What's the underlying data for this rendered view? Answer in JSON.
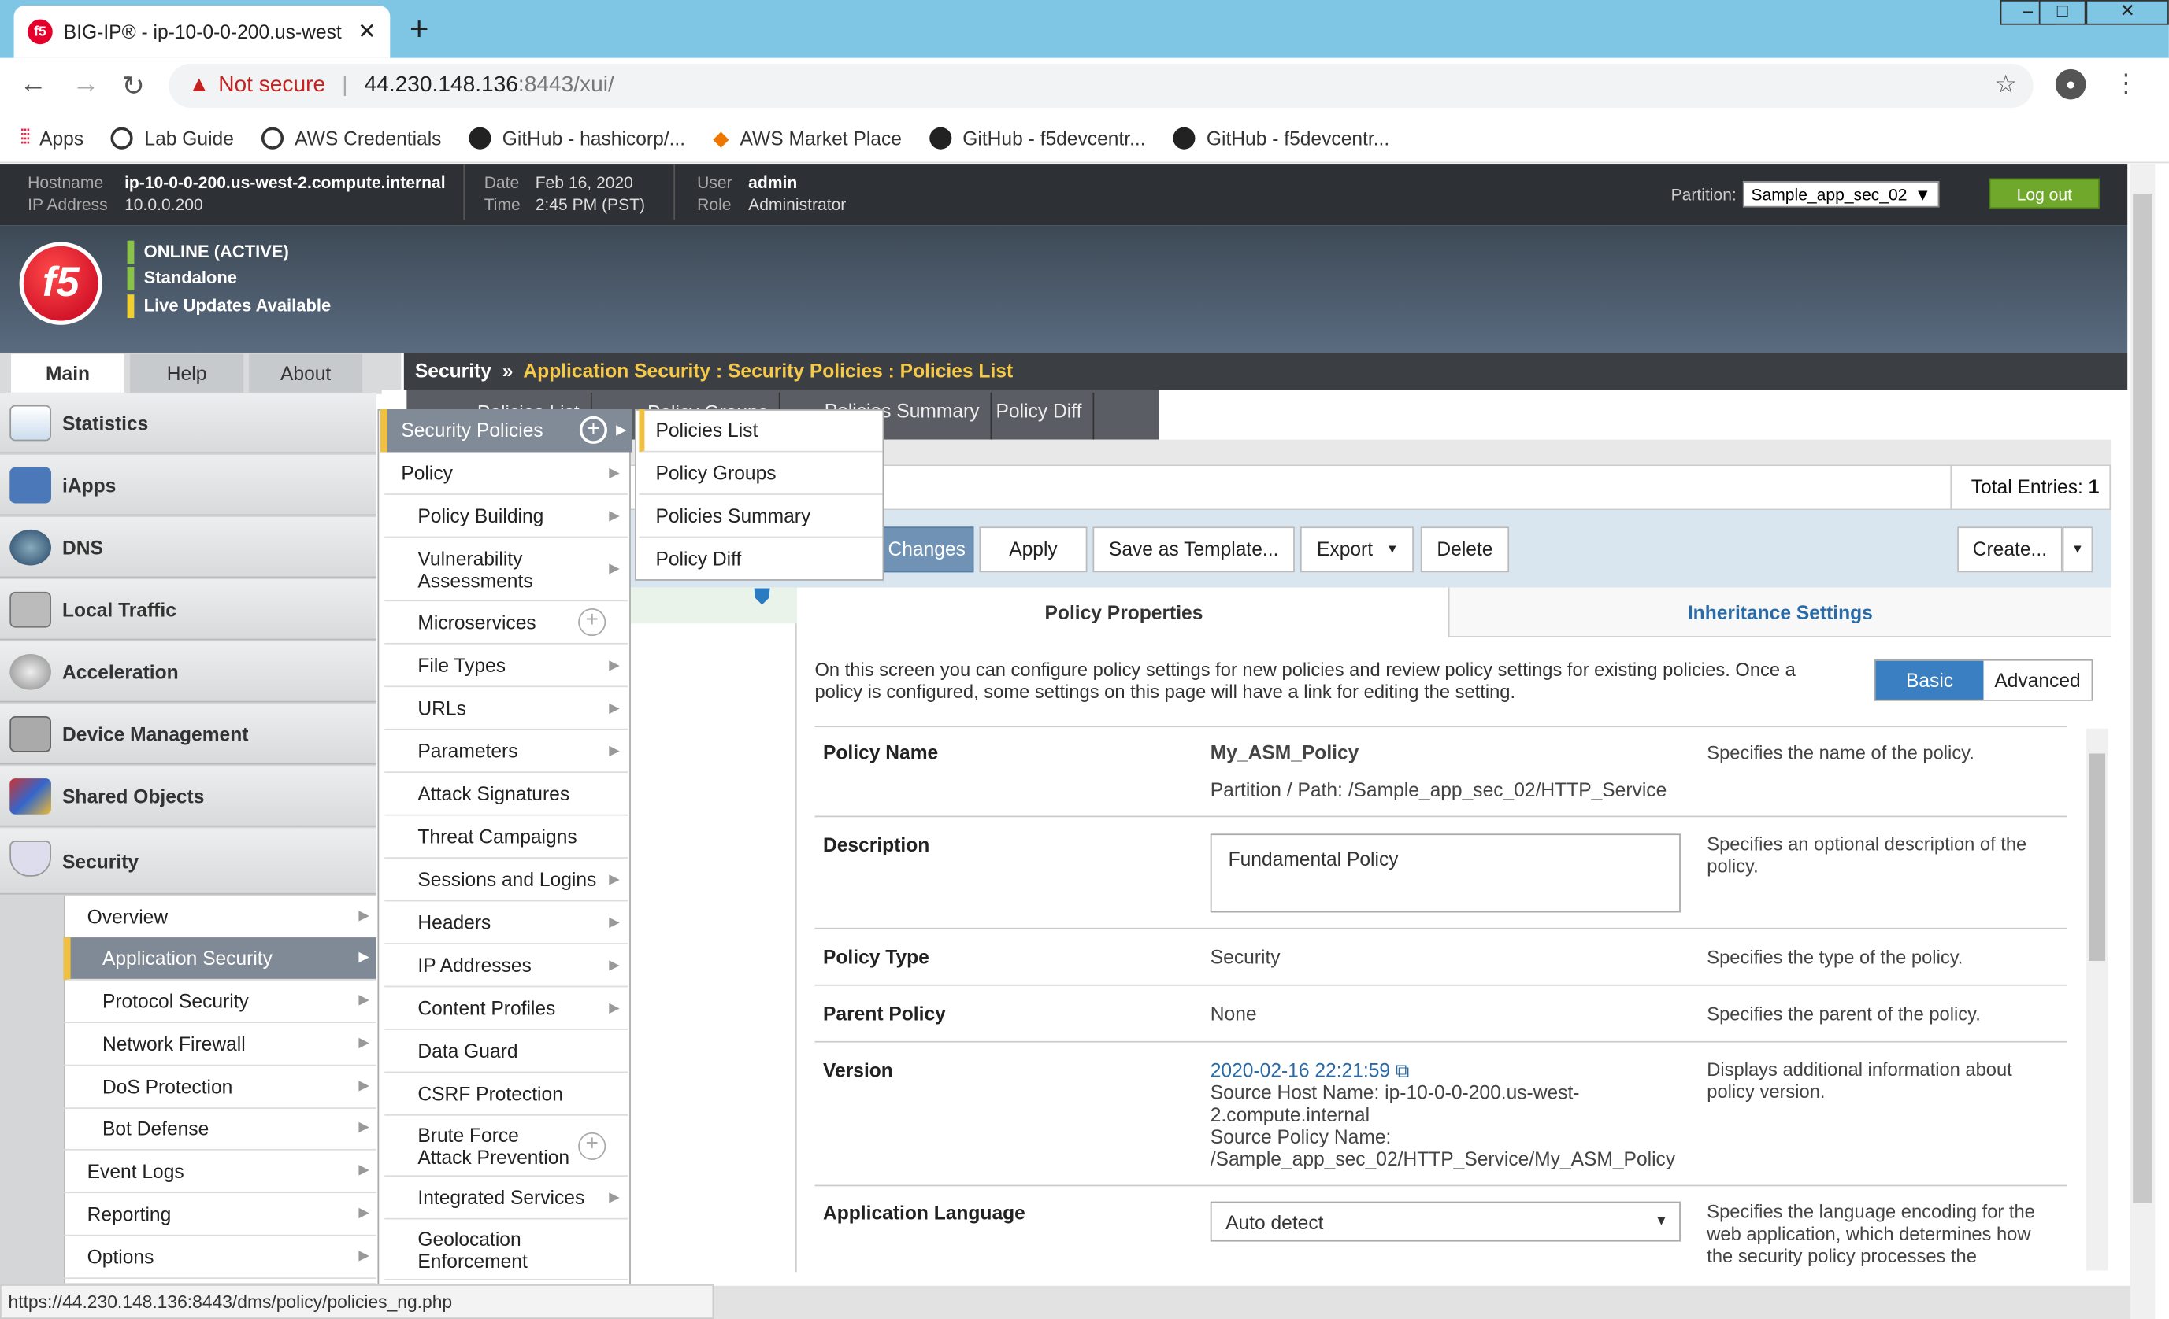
{
  "browser": {
    "tab_title": "BIG-IP® - ip-10-0-0-200.us-west",
    "not_secure": "Not secure",
    "url_host": "44.230.148.136",
    "url_rest": ":8443/xui/",
    "bookmarks": [
      "Apps",
      "Lab Guide",
      "AWS Credentials",
      "GitHub - hashicorp/...",
      "AWS Market Place",
      "GitHub - f5devcentr...",
      "GitHub - f5devcentr..."
    ],
    "status_url": "https://44.230.148.136:8443/dms/policy/policies_ng.php"
  },
  "f5header": {
    "hostname_label": "Hostname",
    "hostname": "ip-10-0-0-200.us-west-2.compute.internal",
    "ip_label": "IP Address",
    "ip": "10.0.0.200",
    "date_label": "Date",
    "date": "Feb 16, 2020",
    "time_label": "Time",
    "time": "2:45 PM (PST)",
    "user_label": "User",
    "user": "admin",
    "role_label": "Role",
    "role": "Administrator",
    "partition_label": "Partition:",
    "partition": "Sample_app_sec_02",
    "logout": "Log out",
    "status": [
      "ONLINE (ACTIVE)",
      "Standalone",
      "Live Updates Available"
    ],
    "logo_text": "f5"
  },
  "main_tabs": [
    "Main",
    "Help",
    "About"
  ],
  "breadcrumb": {
    "root": "Security",
    "sep": "»",
    "path": "Application Security : Security Policies : Policies List"
  },
  "sidebar": {
    "items": [
      "Statistics",
      "iApps",
      "DNS",
      "Local Traffic",
      "Acceleration",
      "Device Management",
      "Shared Objects",
      "Security"
    ],
    "security_sub": [
      "Overview",
      "Application Security",
      "Protocol Security",
      "Network Firewall",
      "DoS Protection",
      "Bot Defense",
      "Event Logs",
      "Reporting",
      "Options"
    ]
  },
  "flyout1": {
    "head": "Security Policies",
    "items": [
      "Policy",
      "Policy Building",
      "Vulnerability Assessments",
      "Microservices",
      "File Types",
      "URLs",
      "Parameters",
      "Attack Signatures",
      "Threat Campaigns",
      "Sessions and Logins",
      "Headers",
      "IP Addresses",
      "Content Profiles",
      "Data Guard",
      "CSRF Protection",
      "Brute Force Attack Prevention",
      "Integrated Services",
      "Geolocation Enforcement"
    ]
  },
  "flyout2": {
    "items": [
      "Policies List",
      "Policy Groups",
      "Policies Summary",
      "Policy Diff"
    ]
  },
  "section_tabs": [
    "Policies List",
    "Policy Groups",
    "Policies Summary",
    "Policy Diff"
  ],
  "list": {
    "total_label": "Total Entries:",
    "total": "1"
  },
  "actions": {
    "changes": "Changes",
    "apply": "Apply",
    "save_template": "Save as Template...",
    "export": "Export",
    "delete": "Delete",
    "create": "Create..."
  },
  "policy_tabs": {
    "properties": "Policy Properties",
    "inheritance": "Inheritance Settings"
  },
  "intro": "On this screen you can configure policy settings for new policies and review policy settings for existing policies. Once a policy is configured, some settings on this page will have a link for editing the setting.",
  "mode": {
    "basic": "Basic",
    "advanced": "Advanced"
  },
  "props": {
    "name_label": "Policy Name",
    "name": "My_ASM_Policy",
    "partition_path": "Partition / Path: /Sample_app_sec_02/HTTP_Service",
    "name_desc": "Specifies the name of the policy.",
    "desc_label": "Description",
    "desc": "Fundamental Policy",
    "desc_desc": "Specifies an optional description of the policy.",
    "type_label": "Policy Type",
    "type": "Security",
    "type_desc": "Specifies the type of the policy.",
    "parent_label": "Parent Policy",
    "parent": "None",
    "parent_desc": "Specifies the parent of the policy.",
    "version_label": "Version",
    "version_link": "2020-02-16 22:21:59",
    "version_host": "Source Host Name: ip-10-0-0-200.us-west-2.compute.internal",
    "version_policy": "Source Policy Name: /Sample_app_sec_02/HTTP_Service/My_ASM_Policy",
    "version_desc": "Displays additional information about policy version.",
    "lang_label": "Application Language",
    "lang": "Auto detect",
    "lang_desc": "Specifies the language encoding for the web application, which determines how the security policy processes the"
  }
}
